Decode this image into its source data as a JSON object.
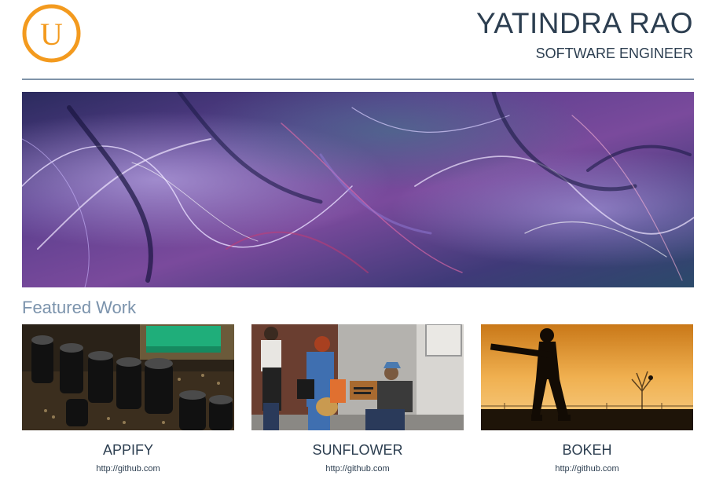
{
  "header": {
    "logo_letter": "U",
    "name": "YATINDRA RAO",
    "role": "SOFTWARE ENGINEER"
  },
  "banner": {
    "alt": "abstract-purple-fractal-image"
  },
  "featured": {
    "heading": "Featured Work",
    "items": [
      {
        "title": "APPIFY",
        "link": "http://github.com",
        "image": "circuit-board-capacitors-photo"
      },
      {
        "title": "SUNFLOWER",
        "link": "http://github.com",
        "image": "street-scene-people-photo"
      },
      {
        "title": "BOKEH",
        "link": "http://github.com",
        "image": "cricket-batsman-silhouette-photo"
      }
    ]
  },
  "colors": {
    "accent_orange": "#f39a1e",
    "heading_dark": "#2c3e50",
    "section_blue": "#7b93ac",
    "divider": "#7f93a8"
  }
}
